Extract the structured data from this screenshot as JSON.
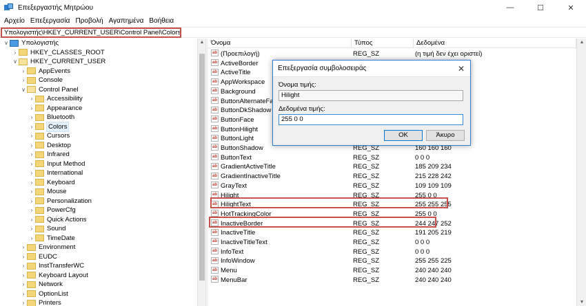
{
  "window": {
    "title": "Επεξεργαστής Μητρώου",
    "minimize": "—",
    "maximize": "☐",
    "close": "✕"
  },
  "menu": [
    "Αρχείο",
    "Επεξεργασία",
    "Προβολή",
    "Αγαπημένα",
    "Βοήθεια"
  ],
  "address": "Υπολογιστής\\HKEY_CURRENT_USER\\Control Panel\\Colors",
  "tree": {
    "root": "Υπολογιστής",
    "hives": [
      "HKEY_CLASSES_ROOT",
      "HKEY_CURRENT_USER"
    ],
    "hkcu_children_before": [
      "AppEvents",
      "Console",
      "Control Panel"
    ],
    "control_panel_children": [
      "Accessibility",
      "Appearance",
      "Bluetooth",
      "Colors",
      "Cursors",
      "Desktop",
      "Infrared",
      "Input Method",
      "International",
      "Keyboard",
      "Mouse",
      "Personalization",
      "PowerCfg",
      "Quick Actions",
      "Sound",
      "TimeDate"
    ],
    "hkcu_children_after": [
      "Environment",
      "EUDC",
      "InstTransferWC",
      "Keyboard Layout",
      "Network",
      "OptionList",
      "Printers"
    ],
    "selected": "Colors"
  },
  "columns": {
    "name": "Όνομα",
    "type": "Τύπος",
    "data": "Δεδομένα"
  },
  "values": [
    {
      "name": "(Προεπιλογή)",
      "type": "REG_SZ",
      "data": "(η τιμή δεν έχει οριστεί)"
    },
    {
      "name": "ActiveBorder",
      "type": "",
      "data": ""
    },
    {
      "name": "ActiveTitle",
      "type": "",
      "data": ""
    },
    {
      "name": "AppWorkspace",
      "type": "",
      "data": ""
    },
    {
      "name": "Background",
      "type": "",
      "data": ""
    },
    {
      "name": "ButtonAlternateFace",
      "type": "",
      "data": ""
    },
    {
      "name": "ButtonDkShadow",
      "type": "",
      "data": ""
    },
    {
      "name": "ButtonFace",
      "type": "",
      "data": ""
    },
    {
      "name": "ButtonHilight",
      "type": "",
      "data": ""
    },
    {
      "name": "ButtonLight",
      "type": "",
      "data": ""
    },
    {
      "name": "ButtonShadow",
      "type": "REG_SZ",
      "data": "160 160 160"
    },
    {
      "name": "ButtonText",
      "type": "REG_SZ",
      "data": "0 0 0"
    },
    {
      "name": "GradientActiveTitle",
      "type": "REG_SZ",
      "data": "185 209 234"
    },
    {
      "name": "GradientInactiveTitle",
      "type": "REG_SZ",
      "data": "215 228 242"
    },
    {
      "name": "GrayText",
      "type": "REG_SZ",
      "data": "109 109 109"
    },
    {
      "name": "Hilight",
      "type": "REG_SZ",
      "data": "255 0 0"
    },
    {
      "name": "HilightText",
      "type": "REG_SZ",
      "data": "255 255 255"
    },
    {
      "name": "HotTrackingColor",
      "type": "REG_SZ",
      "data": "255 0 0"
    },
    {
      "name": "InactiveBorder",
      "type": "REG_SZ",
      "data": "244 247 252"
    },
    {
      "name": "InactiveTitle",
      "type": "REG_SZ",
      "data": "191 205 219"
    },
    {
      "name": "InactiveTitleText",
      "type": "REG_SZ",
      "data": "0 0 0"
    },
    {
      "name": "InfoText",
      "type": "REG_SZ",
      "data": "0 0 0"
    },
    {
      "name": "InfoWindow",
      "type": "REG_SZ",
      "data": "255 255 225"
    },
    {
      "name": "Menu",
      "type": "REG_SZ",
      "data": "240 240 240"
    },
    {
      "name": "MenuBar",
      "type": "REG_SZ",
      "data": "240 240 240"
    }
  ],
  "dialog": {
    "title": "Επεξεργασία συμβολοσειράς",
    "close": "✕",
    "name_label": "Όνομα τιμής:",
    "name_value": "Hilight",
    "data_label": "Δεδομένα τιμής:",
    "data_value": "255 0 0",
    "ok_label": "OK",
    "cancel_label": "Άκυρο"
  },
  "colors": {
    "highlight_border": "#c8504a",
    "dialog_accent": "#0078d7"
  }
}
